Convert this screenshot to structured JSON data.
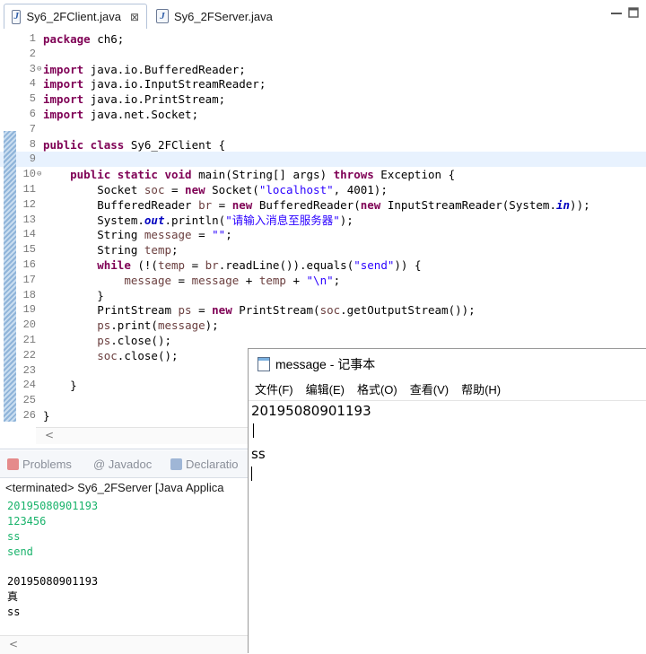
{
  "tabs": [
    {
      "label": "Sy6_2FClient.java",
      "close": "⊠",
      "icon": "java-file-icon",
      "active": true
    },
    {
      "label": "Sy6_2FServer.java",
      "icon": "java-file-icon",
      "active": false
    }
  ],
  "editor": {
    "current_line": 9,
    "lines": [
      {
        "n": "1",
        "fold": "",
        "html": "<span class=\"kw\">package</span> ch6;"
      },
      {
        "n": "2",
        "fold": "",
        "html": ""
      },
      {
        "n": "3",
        "fold": "⊖",
        "html": "<span class=\"kw\">import</span> java.io.BufferedReader;"
      },
      {
        "n": "4",
        "fold": "",
        "html": "<span class=\"kw\">import</span> java.io.InputStreamReader;"
      },
      {
        "n": "5",
        "fold": "",
        "html": "<span class=\"kw\">import</span> java.io.PrintStream;"
      },
      {
        "n": "6",
        "fold": "",
        "html": "<span class=\"kw\">import</span> java.net.Socket;"
      },
      {
        "n": "7",
        "fold": "",
        "html": ""
      },
      {
        "n": "8",
        "fold": "",
        "html": "<span class=\"kw\">public class</span> Sy6_2FClient {"
      },
      {
        "n": "9",
        "fold": "",
        "html": ""
      },
      {
        "n": "10",
        "fold": "⊖",
        "html": "    <span class=\"kw\">public static void</span> main(String[] args) <span class=\"kw\">throws</span> Exception {"
      },
      {
        "n": "11",
        "fold": "",
        "html": "        Socket <span class=\"var\">soc</span> = <span class=\"kw\">new</span> Socket(<span class=\"str\">\"localhost\"</span>, 4001);"
      },
      {
        "n": "12",
        "fold": "",
        "html": "        BufferedReader <span class=\"var\">br</span> = <span class=\"kw\">new</span> BufferedReader(<span class=\"kw\">new</span> InputStreamReader(System.<span class=\"fld\">in</span>));"
      },
      {
        "n": "13",
        "fold": "",
        "html": "        System.<span class=\"fld\">out</span>.println(<span class=\"str\">\"请输入消息至服务器\"</span>);"
      },
      {
        "n": "14",
        "fold": "",
        "html": "        String <span class=\"var\">message</span> = <span class=\"str\">\"\"</span>;"
      },
      {
        "n": "15",
        "fold": "",
        "html": "        String <span class=\"var\">temp</span>;"
      },
      {
        "n": "16",
        "fold": "",
        "html": "        <span class=\"kw\">while</span> (!(<span class=\"var\">temp</span> = <span class=\"var\">br</span>.readLine()).equals(<span class=\"str\">\"send\"</span>)) {"
      },
      {
        "n": "17",
        "fold": "",
        "html": "            <span class=\"var\">message</span> = <span class=\"var\">message</span> + <span class=\"var\">temp</span> + <span class=\"str\">\"\\n\"</span>;"
      },
      {
        "n": "18",
        "fold": "",
        "html": "        }"
      },
      {
        "n": "19",
        "fold": "",
        "html": "        PrintStream <span class=\"var\">ps</span> = <span class=\"kw\">new</span> PrintStream(<span class=\"var\">soc</span>.getOutputStream());"
      },
      {
        "n": "20",
        "fold": "",
        "html": "        <span class=\"var\">ps</span>.print(<span class=\"var\">message</span>);"
      },
      {
        "n": "21",
        "fold": "",
        "html": "        <span class=\"var\">ps</span>.close();"
      },
      {
        "n": "22",
        "fold": "",
        "html": "        <span class=\"var\">soc</span>.close();"
      },
      {
        "n": "23",
        "fold": "",
        "html": ""
      },
      {
        "n": "24",
        "fold": "",
        "html": "    }"
      },
      {
        "n": "25",
        "fold": "",
        "html": ""
      },
      {
        "n": "26",
        "fold": "",
        "html": "}"
      }
    ],
    "scroll_left": "<"
  },
  "views": {
    "tabs": [
      {
        "label": "Problems",
        "icon": "problems-icon"
      },
      {
        "label": "@ Javadoc",
        "icon": ""
      },
      {
        "label": "Declaratio",
        "icon": "declaration-icon"
      }
    ]
  },
  "console": {
    "title": "<terminated> Sy6_2FServer [Java Applica",
    "input_lines": [
      "20195080901193",
      "123456",
      "ss",
      "send"
    ],
    "output_lines": [
      "20195080901193",
      "真",
      "ss"
    ],
    "scroll_left": "<"
  },
  "notepad": {
    "title": "message - 记事本",
    "menu": [
      "文件(F)",
      "编辑(E)",
      "格式(O)",
      "查看(V)",
      "帮助(H)"
    ],
    "lines": [
      "20195080901193",
      "",
      "ss"
    ]
  }
}
